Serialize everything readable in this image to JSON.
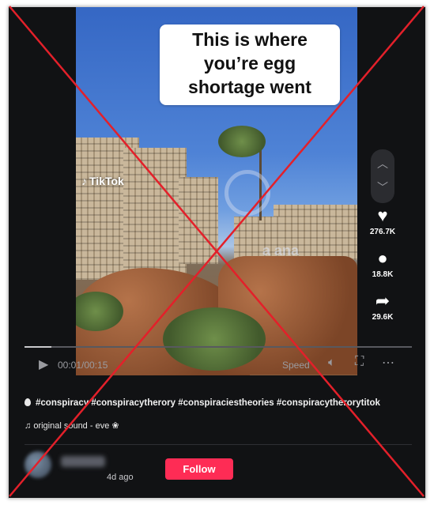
{
  "video": {
    "caption_line1": "This is where you’re egg",
    "caption_line2": "shortage went",
    "logo_text": "TikTok",
    "watermark_text": "a ana",
    "current_time": "00:01",
    "duration": "00:15",
    "time_separator": "/",
    "speed_label": "Speed",
    "progress_fraction": 0.07
  },
  "nav": {
    "up_icon": "chevron-up-icon",
    "down_icon": "chevron-down-icon"
  },
  "actions": {
    "likes": {
      "icon": "heart-icon",
      "count": "276.7K"
    },
    "comments": {
      "icon": "comment-icon",
      "count": "18.8K"
    },
    "shares": {
      "icon": "share-icon",
      "count": "29.6K"
    }
  },
  "post": {
    "hashtags": "#conspiracy #conspiracytherory #conspiraciestheories #conspiracytherorytitok",
    "sound": "original sound - eve ❀",
    "posted_ago": "4d ago",
    "follow_label": "Follow"
  },
  "overlay": {
    "mark": "red-x",
    "color": "#e3202a"
  }
}
